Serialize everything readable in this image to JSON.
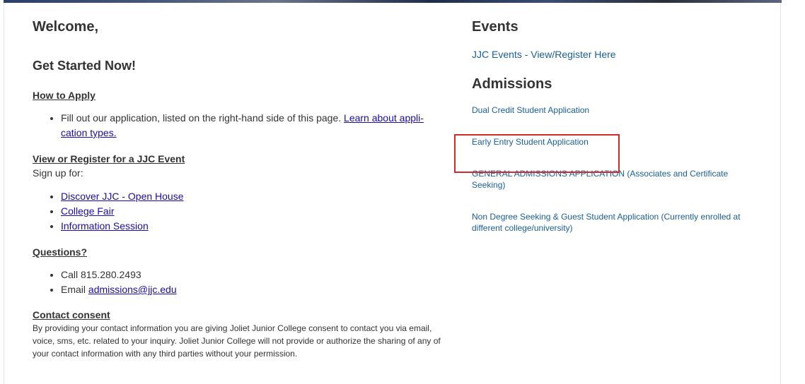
{
  "left": {
    "welcome": "Welcome,",
    "get_started": "Get Started Now!",
    "how_to_apply": {
      "heading": "How to Apply",
      "item_text": "Fill out our application, listed on the right-hand side of this page.",
      "item_link_line1": "Learn about appli-",
      "item_link_line2": "cation types."
    },
    "event_section": {
      "heading": "View or Register for a JJC Event",
      "intro": "Sign up for:",
      "items": [
        "Discover JJC - Open House",
        "College Fair",
        "Information Session"
      ]
    },
    "questions": {
      "heading": "Questions?",
      "call": "Call 815.280.2493",
      "email_label": "Email",
      "email": "admissions@jjc.edu"
    },
    "consent": {
      "heading": "Contact consent",
      "text": "By providing your contact information you are giving Joliet Junior College consent to contact you via email, voice, sms, etc. related to your inquiry. Joliet Junior College will not provide or authorize the sharing of any of your contact information with any third parties without your permission."
    }
  },
  "right": {
    "events_title": "Events",
    "events_link": "JJC Events - View/Register Here",
    "admissions_title": "Admissions",
    "applications": [
      "Dual Credit Student Application",
      "Early Entry Student Application",
      "GENERAL ADMISSIONS APPLICATION (Associates and Certificate Seeking)",
      "Non Degree Seeking & Guest Student Application (Currently enrolled at different college/university)"
    ]
  },
  "colors": {
    "link": "#1a0dab",
    "right_link": "#1a5fa0",
    "highlight": "#d12b2b"
  }
}
